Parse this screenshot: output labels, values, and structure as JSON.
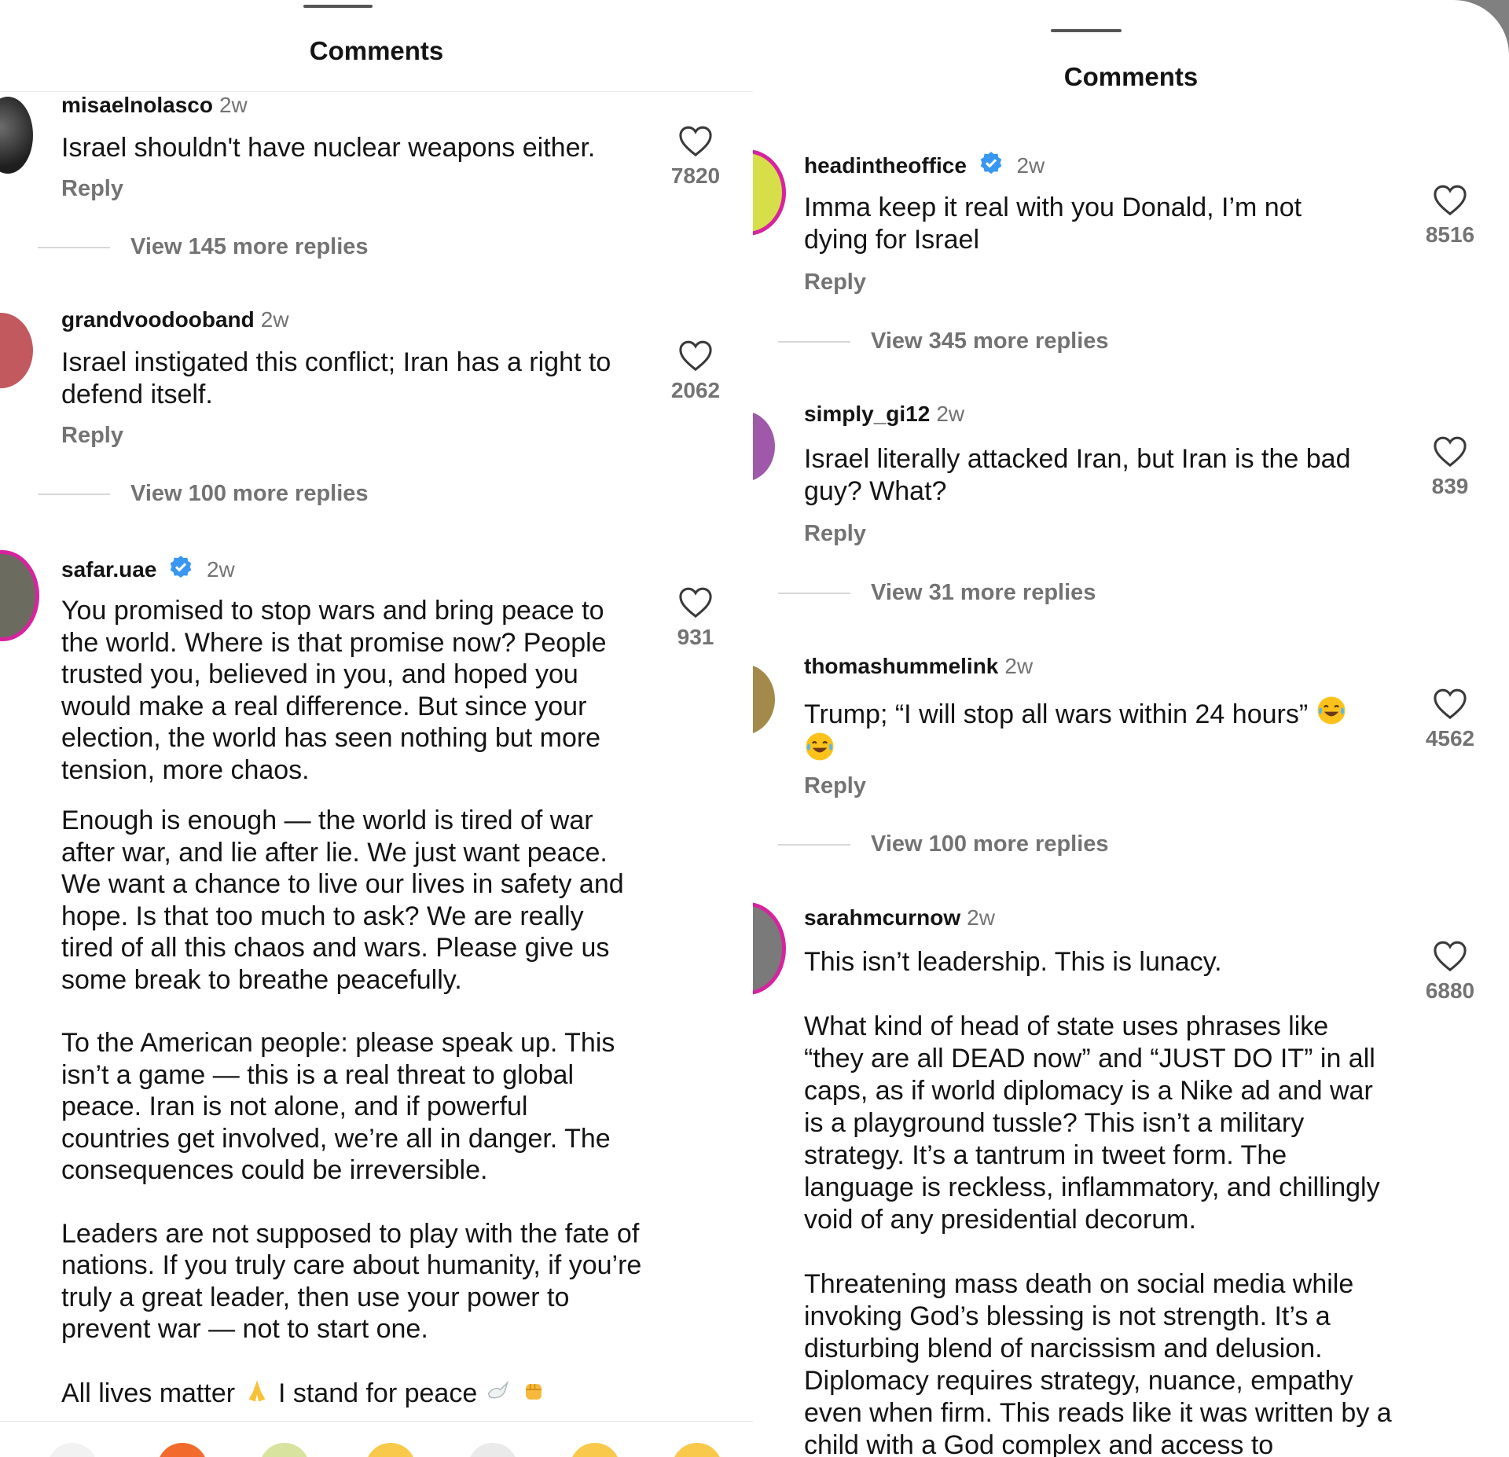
{
  "left": {
    "title": "Comments",
    "comments": [
      {
        "username": "misaelnolasco",
        "time": "2w",
        "paragraphs": [
          "Israel shouldn't have nuclear weapons either."
        ],
        "reply": "Reply",
        "likes": "7820",
        "view_more": "View 145 more replies"
      },
      {
        "username": "grandvoodooband",
        "time": "2w",
        "paragraphs": [
          "Israel instigated this conflict; Iran has a right to defend itself."
        ],
        "reply": "Reply",
        "likes": "2062",
        "view_more": "View 100 more replies"
      },
      {
        "username": "safar.uae",
        "verified": true,
        "time": "2w",
        "paragraphs": [
          "You promised to stop wars and bring peace to the world. Where is that promise now? People trusted you, believed in you, and hoped you would make a real difference. But since your election, the world has seen nothing but more tension, more chaos.",
          "Enough is enough — the world is tired of war after war, and lie after lie. We just want peace. We want a chance to live our lives in safety and hope. Is that too much to ask? We are really tired of all this chaos and wars. Please give us some break to breathe peacefully.",
          "To the American people: please speak up. This isn’t a game — this is a real threat to global peace. Iran is not alone, and if powerful countries get involved, we’re all in danger. The consequences could be irreversible.",
          "Leaders are not supposed to play with the fate of nations. If you truly care about humanity, if you’re truly a great leader, then use your power to prevent war — not to start one."
        ],
        "final_line_a": "All lives matter",
        "final_line_b": "I stand for peace",
        "likes": "931"
      }
    ]
  },
  "right": {
    "title": "Comments",
    "comments": [
      {
        "username": "headintheoffice",
        "verified": true,
        "time": "2w",
        "paragraphs": [
          "Imma keep it real with you Donald, I’m not dying for Israel"
        ],
        "reply": "Reply",
        "likes": "8516",
        "view_more": "View 345 more replies"
      },
      {
        "username": "simply_gi12",
        "time": "2w",
        "paragraphs": [
          "Israel literally attacked Iran, but Iran is the bad guy? What?"
        ],
        "reply": "Reply",
        "likes": "839",
        "view_more": "View 31 more replies"
      },
      {
        "username": "thomashummelink",
        "time": "2w",
        "paragraphs": [
          "Trump; “I will stop all wars within 24 hours”"
        ],
        "reply": "Reply",
        "likes": "4562",
        "view_more": "View 100 more replies"
      },
      {
        "username": "sarahmcurnow",
        "time": "2w",
        "paragraphs": [
          "This isn’t leadership. This is lunacy.",
          "What kind of head of state uses phrases like “they are all DEAD now” and “JUST DO IT” in all caps, as if world diplomacy is a Nike ad and war is a playground tussle? This isn’t a military strategy. It’s a tantrum in tweet form. The language is reckless, inflammatory, and chillingly void of any presidential decorum.",
          "Threatening mass death on social media while invoking God’s blessing is not strength. It’s a disturbing blend of narcissism and delusion. Diplomacy requires strategy, nuance, empathy even when firm. This reads like it was written by a child with a God complex and access to"
        ],
        "likes": "6880"
      }
    ]
  },
  "icons": {
    "like": "heart-outline-icon",
    "verified": "verified-badge-icon",
    "laugh": "tears-of-joy-emoji",
    "pray": "folded-hands-emoji",
    "dove": "dove-emoji",
    "fist": "raised-fist-emoji"
  },
  "colors": {
    "text": "#141414",
    "secondary": "#737373",
    "verified": "#3897f0",
    "background": "#ffffff",
    "frame": "#808080",
    "story_ring": "#d6249f"
  }
}
